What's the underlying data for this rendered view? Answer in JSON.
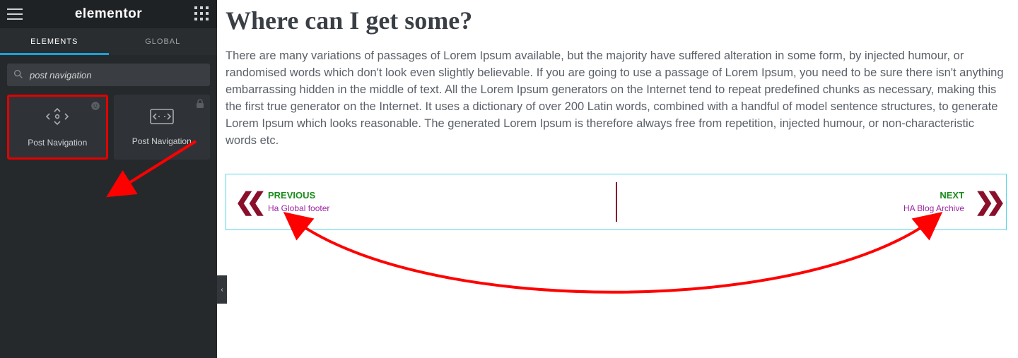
{
  "sidebar": {
    "logo": "elementor",
    "tabs": {
      "elements": "ELEMENTS",
      "global": "GLOBAL"
    },
    "search": {
      "placeholder": "post navigation",
      "value": "post navigation"
    },
    "widgets": {
      "first": "Post Navigation",
      "second": "Post Navigation"
    }
  },
  "canvas": {
    "title": "Where can I get some?",
    "body": "There are many variations of passages of Lorem Ipsum available, but the majority have suffered alteration in some form, by injected humour, or randomised words which don't look even slightly believable. If you are going to use a passage of Lorem Ipsum, you need to be sure there isn't anything embarrassing hidden in the middle of text. All the Lorem Ipsum generators on the Internet tend to repeat predefined chunks as necessary, making this the first true generator on the Internet. It uses a dictionary of over 200 Latin words, combined with a handful of model sentence structures, to generate Lorem Ipsum which looks reasonable. The generated Lorem Ipsum is therefore always free from repetition, injected humour, or non-characteristic words etc.",
    "nav": {
      "prev": {
        "label": "PREVIOUS",
        "title": "Ha Global footer"
      },
      "next": {
        "label": "NEXT",
        "title": "HA Blog Archive"
      }
    }
  },
  "collapse_glyph": "‹"
}
